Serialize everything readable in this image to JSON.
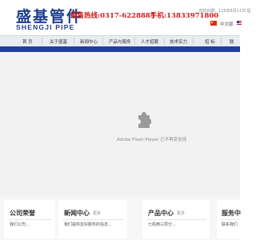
{
  "header": {
    "logo_cn": "盛基管件",
    "logo_en": "SHENGJI PIPE",
    "hotline": "销售热线:0317-6228885",
    "mobile": "手机:13833971800",
    "date": "当前日期：125年8月11日 星",
    "lang_cn": "中文版"
  },
  "nav": {
    "items": [
      "首 页",
      "关于盛基",
      "新闻中心",
      "产品与服务",
      "人才招聘",
      "技术实力",
      "招 标",
      "联"
    ]
  },
  "flash": {
    "message": "Adobe Flash Player 已不再受支持"
  },
  "panels": [
    {
      "title": "公司荣誉",
      "more": "",
      "body": "我们公司..."
    },
    {
      "title": "新闻中心",
      "more": "更多",
      "body": "我们提供友好服务的信息..."
    },
    {
      "title": "产品中心",
      "more": "更多",
      "body": "七机两三层分..."
    },
    {
      "title": "服务中",
      "more": "",
      "body": "联系我们"
    }
  ],
  "colors": {
    "brand_blue": "#1e3f8c",
    "band_blue": "#213f9a",
    "hotline_red": "#d01818"
  }
}
